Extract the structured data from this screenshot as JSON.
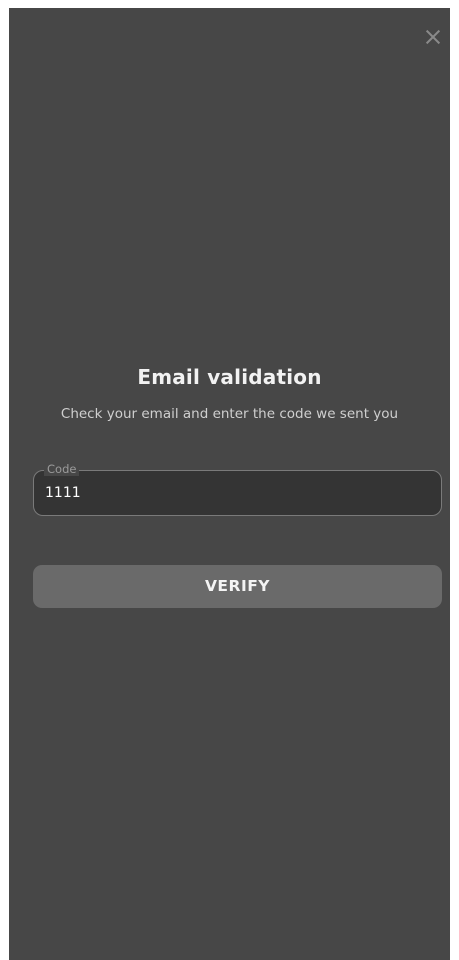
{
  "dialog": {
    "close_icon": "close-icon",
    "title": "Email validation",
    "subtitle": "Check your email and enter the code we sent you",
    "code_field": {
      "label": "Code",
      "value": "1111"
    },
    "verify_label": "VERIFY"
  },
  "colors": {
    "background": "#474747",
    "field_background": "#343434",
    "button_background": "#6a6a6a",
    "text_primary": "#f2f2f2"
  }
}
